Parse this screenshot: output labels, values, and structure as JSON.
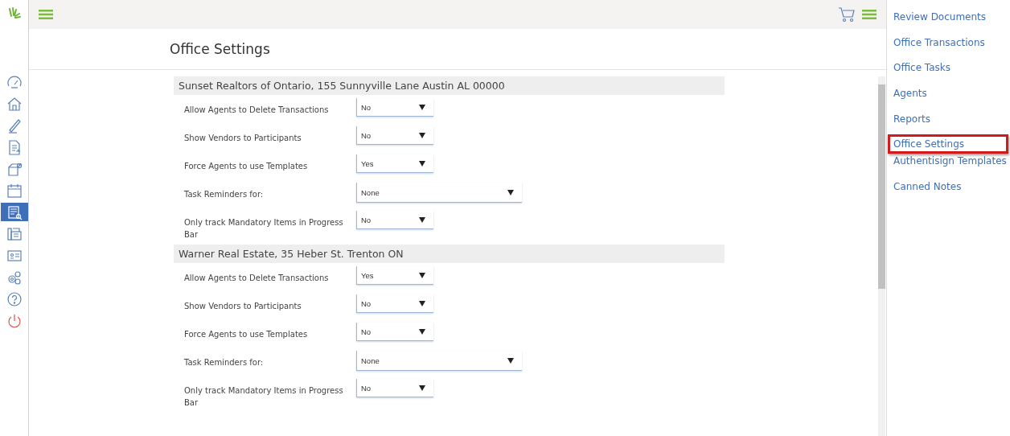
{
  "sidebar": {
    "items": [
      {
        "kind": "gauge",
        "selected": false
      },
      {
        "kind": "home",
        "selected": false
      },
      {
        "kind": "pen",
        "selected": false
      },
      {
        "kind": "document",
        "selected": false
      },
      {
        "kind": "box",
        "selected": false
      },
      {
        "kind": "calendar",
        "selected": false
      },
      {
        "kind": "report",
        "selected": true
      },
      {
        "kind": "fax",
        "selected": false
      },
      {
        "kind": "card",
        "selected": false
      },
      {
        "kind": "gears",
        "selected": false
      },
      {
        "kind": "help",
        "selected": false
      },
      {
        "kind": "power",
        "selected": false
      }
    ]
  },
  "page": {
    "title": "Office Settings"
  },
  "offices": [
    {
      "name": "Sunset Realtors of Ontario, 155 Sunnyville Lane Austin AL 00000",
      "settings": [
        {
          "label": "Allow Agents to Delete Transactions",
          "value": "No",
          "kind": "short"
        },
        {
          "label": "Show Vendors to Participants",
          "value": "No",
          "kind": "short"
        },
        {
          "label": "Force Agents to use Templates",
          "value": "Yes",
          "kind": "short"
        },
        {
          "label": "Task Reminders for:",
          "value": "None",
          "kind": "wide"
        },
        {
          "label": "Only track Mandatory Items in Progress Bar",
          "value": "No",
          "kind": "short"
        }
      ]
    },
    {
      "name": "Warner Real Estate, 35 Heber St. Trenton ON",
      "settings": [
        {
          "label": "Allow Agents to Delete Transactions",
          "value": "Yes",
          "kind": "short"
        },
        {
          "label": "Show Vendors to Participants",
          "value": "No",
          "kind": "short"
        },
        {
          "label": "Force Agents to use Templates",
          "value": "No",
          "kind": "short"
        },
        {
          "label": "Task Reminders for:",
          "value": "None",
          "kind": "wide"
        },
        {
          "label": "Only track Mandatory Items in Progress Bar",
          "value": "No",
          "kind": "short"
        }
      ]
    }
  ],
  "right_nav": {
    "items": [
      {
        "label": "Review Documents",
        "selected": false
      },
      {
        "label": "Office Transactions",
        "selected": false
      },
      {
        "label": "Office Tasks",
        "selected": false
      },
      {
        "label": "Agents",
        "selected": false
      },
      {
        "label": "Reports",
        "selected": false
      },
      {
        "label": "Office Settings",
        "selected": true
      },
      {
        "label": "Authentisign Templates",
        "selected": false
      },
      {
        "label": "Canned Notes",
        "selected": false
      }
    ]
  }
}
